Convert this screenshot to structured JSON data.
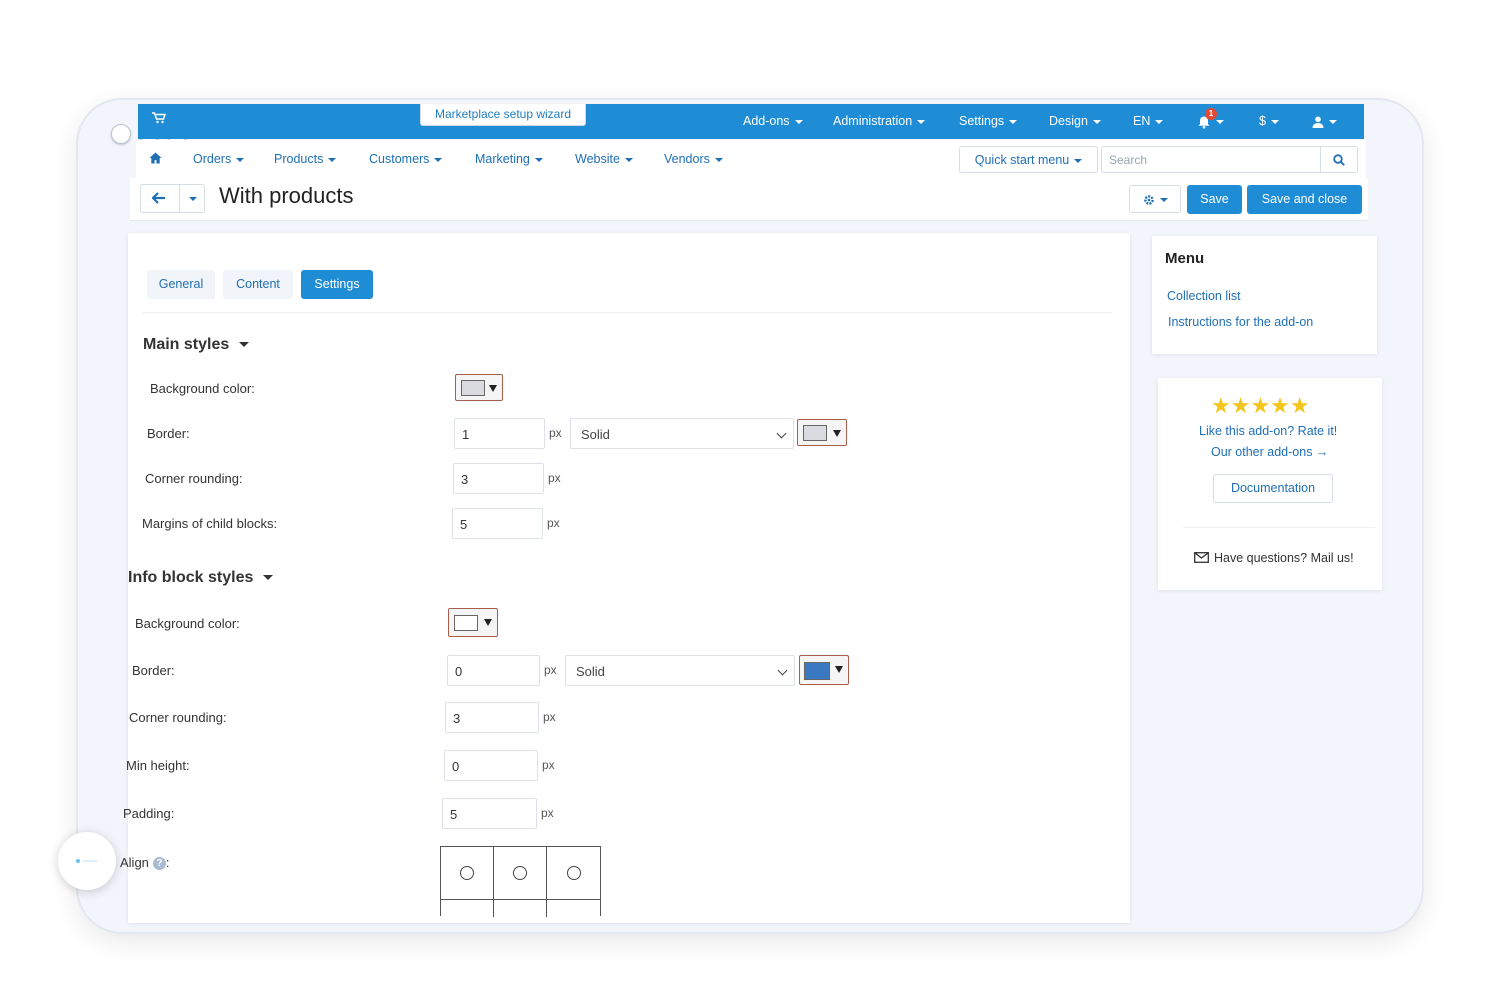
{
  "header": {
    "wizard_label": "Marketplace setup wizard",
    "top_nav": [
      {
        "label": "Add-ons"
      },
      {
        "label": "Administration"
      },
      {
        "label": "Settings"
      },
      {
        "label": "Design"
      },
      {
        "label": "EN"
      }
    ],
    "notification_count": "1",
    "currency": "$"
  },
  "nav": {
    "items": [
      {
        "label": "Orders"
      },
      {
        "label": "Products"
      },
      {
        "label": "Customers"
      },
      {
        "label": "Marketing"
      },
      {
        "label": "Website"
      },
      {
        "label": "Vendors"
      }
    ],
    "quick_start": "Quick start menu",
    "search_placeholder": "Search"
  },
  "page": {
    "title": "With products",
    "save_label": "Save",
    "save_close_label": "Save and close"
  },
  "tabs": [
    {
      "label": "General",
      "active": false
    },
    {
      "label": "Content",
      "active": false
    },
    {
      "label": "Settings",
      "active": true
    }
  ],
  "main_styles": {
    "title": "Main styles",
    "background_label": "Background color:",
    "background_color": "#d9dbe0",
    "border_label": "Border:",
    "border_width": "1",
    "border_unit": "px",
    "border_style": "Solid",
    "border_color": "#d9dbe0",
    "rounding_label": "Corner rounding:",
    "rounding_value": "3",
    "rounding_unit": "px",
    "margins_label": "Margins of child blocks:",
    "margins_value": "5",
    "margins_unit": "px"
  },
  "info_styles": {
    "title": "Info block styles",
    "background_label": "Background color:",
    "background_color": "#ffffff",
    "border_label": "Border:",
    "border_width": "0",
    "border_unit": "px",
    "border_style": "Solid",
    "border_color": "#3a78c2",
    "rounding_label": "Corner rounding:",
    "rounding_value": "3",
    "rounding_unit": "px",
    "min_height_label": "Min height:",
    "min_height_value": "0",
    "min_height_unit": "px",
    "padding_label": "Padding:",
    "padding_value": "5",
    "padding_unit": "px",
    "align_label": "Align",
    "align_colon": ":"
  },
  "sidebar": {
    "menu_title": "Menu",
    "links": [
      {
        "label": "Collection list"
      },
      {
        "label": "Instructions for the add-on"
      }
    ],
    "rating": 5,
    "rating_stars": "★★★★★",
    "rate_text": "Like this add-on? Rate it!",
    "other_addons": "Our other add-ons →",
    "documentation": "Documentation",
    "mail_text": "Have questions? Mail us!"
  },
  "colors": {
    "primary": "#1f8dd6",
    "link": "#1f6fb5",
    "star": "#f4c51c"
  },
  "icons": {
    "cart": "shopping-cart-icon",
    "home": "home-icon",
    "bell": "bell-icon",
    "user": "user-icon",
    "search": "search-icon",
    "gear": "gear-icon",
    "back": "arrow-left-icon",
    "mail": "envelope-icon",
    "help": "question-circle-icon"
  }
}
